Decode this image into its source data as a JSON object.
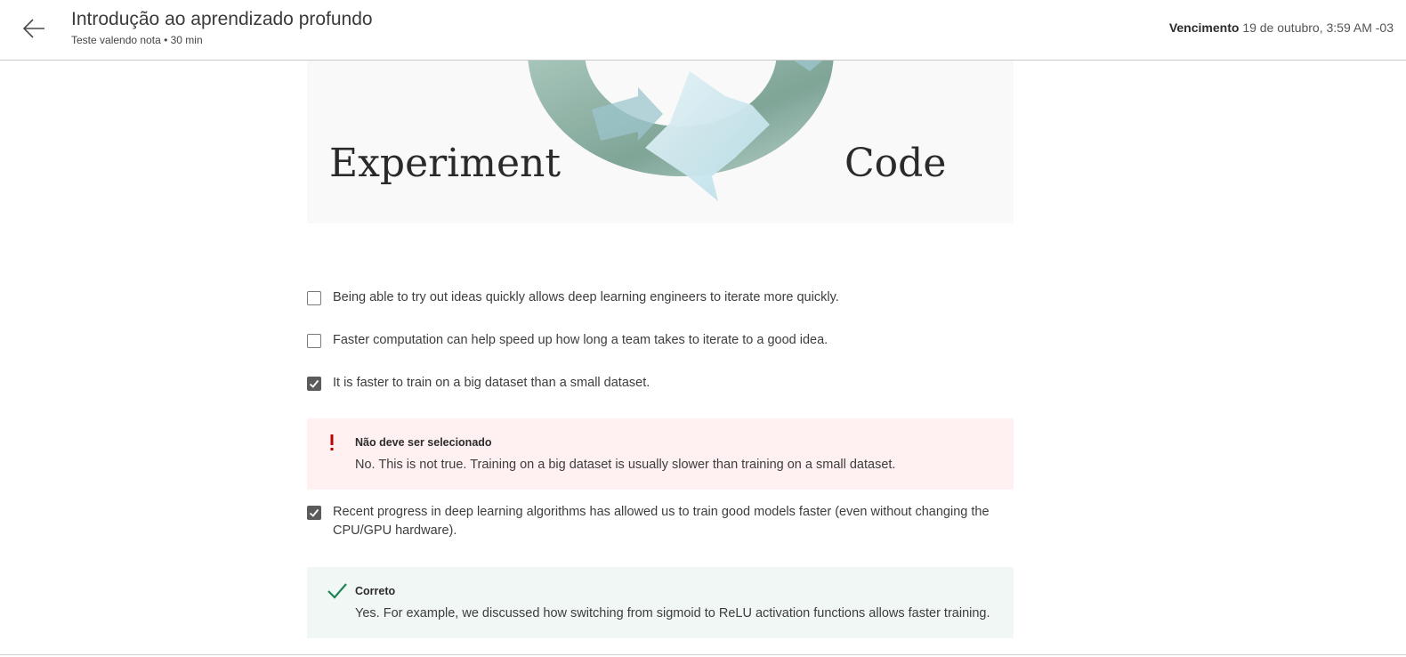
{
  "header": {
    "title": "Introdução ao aprendizado profundo",
    "subtitle": "Teste valendo nota • 30 min",
    "due_label": "Vencimento",
    "due_value": "19 de outubro, 3:59 AM -03",
    "back_icon": "arrow-left-icon"
  },
  "figure": {
    "left_label": "Experiment",
    "right_label": "Code"
  },
  "options": [
    {
      "text": "Being able to try out ideas quickly allows deep learning engineers to iterate more quickly.",
      "checked": false
    },
    {
      "text": "Faster computation can help speed up how long a team takes to iterate to a good idea.",
      "checked": false
    },
    {
      "text": "It is faster to train on a big dataset than a small dataset.",
      "checked": true
    },
    {
      "text": "Recent progress in deep learning algorithms has allowed us to train good models faster (even without changing the CPU/GPU hardware).",
      "checked": true
    }
  ],
  "feedback": {
    "incorrect": {
      "title": "Não deve ser selecionado",
      "text": "No. This is not true. Training on a big dataset is usually slower than training on a small dataset.",
      "icon": "exclamation-icon",
      "color": "#c00000"
    },
    "correct": {
      "title": "Correto",
      "text": "Yes. For example, we discussed how switching from sigmoid to ReLU activation functions allows faster training.",
      "icon": "checkmark-icon",
      "color": "#1f8354"
    }
  }
}
